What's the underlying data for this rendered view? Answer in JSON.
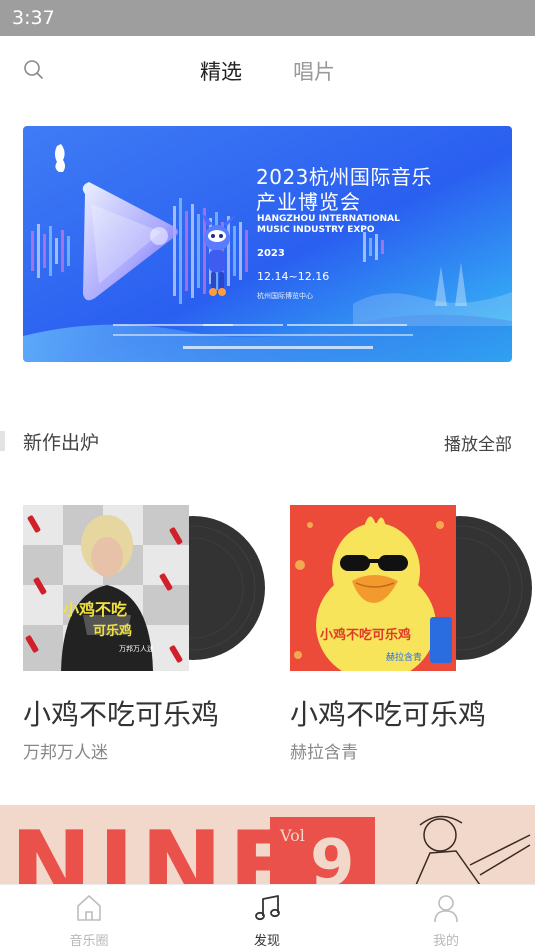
{
  "status_bar": {
    "time": "3:37"
  },
  "top_nav": {
    "tabs": [
      {
        "label": "精选",
        "active": true
      },
      {
        "label": "唱片",
        "active": false
      }
    ]
  },
  "banner": {
    "title_line1": "2023杭州国际音乐",
    "title_line2": "产业博览会",
    "english": "HANGZHOU INTERNATIONAL MUSIC INDUSTRY EXPO",
    "year": "2023",
    "dates": "12.14~12.16",
    "venue": "杭州国际博览中心"
  },
  "section": {
    "title": "新作出炉",
    "play_all_label": "播放全部"
  },
  "albums": [
    {
      "title": "小鸡不吃可乐鸡",
      "artist": "万邦万人迷"
    },
    {
      "title": "小鸡不吃可乐鸡",
      "artist": "赫拉含青"
    }
  ],
  "promo": {
    "text": "NINE",
    "vol": "Vol",
    "number": "9"
  },
  "tabbar": {
    "items": [
      {
        "label": "音乐圈",
        "icon": "home-icon",
        "active": false
      },
      {
        "label": "发现",
        "icon": "music-note-icon",
        "active": true
      },
      {
        "label": "我的",
        "icon": "user-icon",
        "active": false
      }
    ]
  },
  "colors": {
    "accent": "#333333",
    "inactive": "#b8b8b8",
    "banner_blue": "#2a5cf0"
  }
}
